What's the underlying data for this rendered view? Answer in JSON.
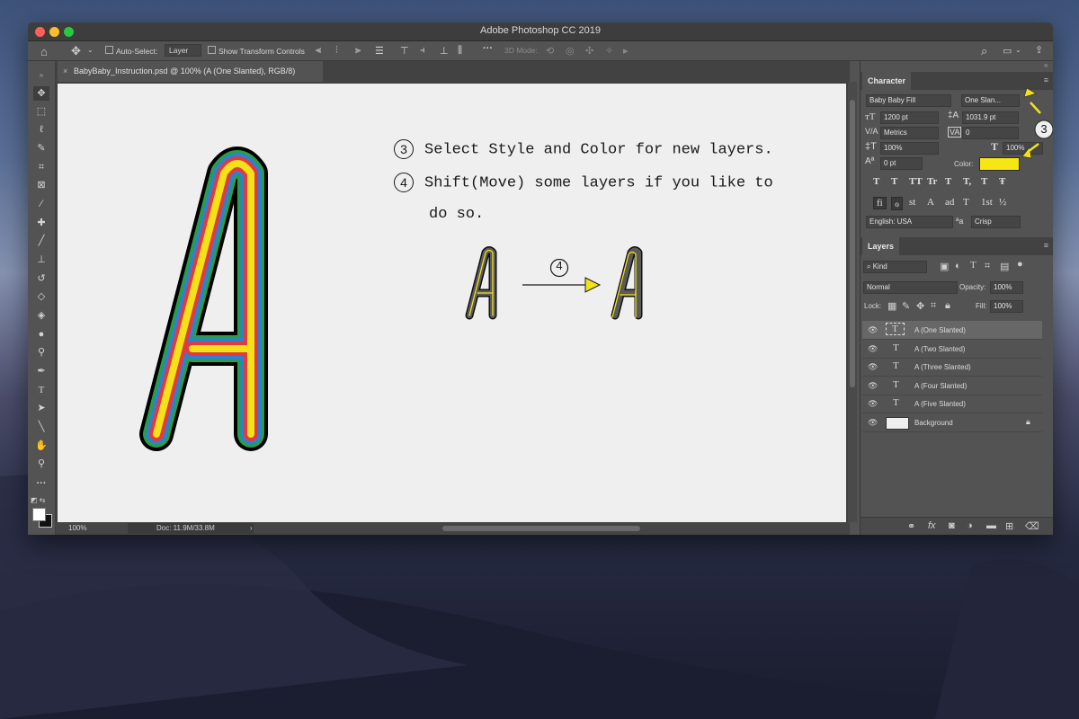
{
  "window": {
    "title": "Adobe Photoshop CC 2019"
  },
  "options_bar": {
    "auto_select_label": "Auto-Select:",
    "auto_select_value": "Layer",
    "show_transform_label": "Show Transform Controls",
    "mode_3d_label": "3D Mode:"
  },
  "document_tab": {
    "title": "BabyBaby_Instruction.psd @ 100% (A (One Slanted), RGB/8)"
  },
  "status_bar": {
    "zoom": "100%",
    "doc_size": "Doc: 11.9M/33.8M"
  },
  "canvas": {
    "steps": [
      {
        "number": "3",
        "text": "Select Style and Color for new layers."
      },
      {
        "number": "4",
        "text": "Shift(Move) some layers if you like to"
      }
    ],
    "step4_continuation": "do so.",
    "arrow_step_number": "4",
    "big_letter": "A",
    "small_letter_before": "A",
    "small_letter_after": "A",
    "stripe_colors": [
      "#000000",
      "#2a9d4a",
      "#2e7fd6",
      "#e23b3b",
      "#f3e21a"
    ]
  },
  "character_panel": {
    "tab_label": "Character",
    "font_family": "Baby Baby Fill",
    "font_style": "One Slan...",
    "font_size": "1200 pt",
    "leading": "1031.9 pt",
    "kerning": "Metrics",
    "tracking": "0",
    "vertical_scale": "100%",
    "horizontal_scale": "100%",
    "baseline_shift": "0 pt",
    "color_label": "Color:",
    "color_value": "#f5e614",
    "language": "English: USA",
    "antialias_label": "a",
    "antialias": "Crisp",
    "callout_number": "3",
    "glyph_buttons": [
      "T",
      "T",
      "TT",
      "Tr",
      "T",
      "T,",
      "T",
      "Ŧ"
    ],
    "opentype_buttons": [
      "fi",
      "ℴ",
      "st",
      "A",
      "ad",
      "T",
      "1st",
      "½"
    ]
  },
  "layers_panel": {
    "tab_label": "Layers",
    "filter_kind": "Kind",
    "blend_mode": "Normal",
    "opacity_label": "Opacity:",
    "opacity": "100%",
    "lock_label": "Lock:",
    "fill_label": "Fill:",
    "fill": "100%",
    "layers": [
      {
        "name": "A (One Slanted)",
        "type": "text",
        "selected": true
      },
      {
        "name": "A (Two Slanted)",
        "type": "text",
        "selected": false
      },
      {
        "name": "A (Three Slanted)",
        "type": "text",
        "selected": false
      },
      {
        "name": "A (Four Slanted)",
        "type": "text",
        "selected": false
      },
      {
        "name": "A (Five Slanted)",
        "type": "text",
        "selected": false
      },
      {
        "name": "Background",
        "type": "image",
        "selected": false
      }
    ],
    "footer_icons": [
      "link-icon",
      "fx-icon",
      "mask-icon",
      "adjustment-icon",
      "group-icon",
      "new-layer-icon",
      "trash-icon"
    ]
  }
}
